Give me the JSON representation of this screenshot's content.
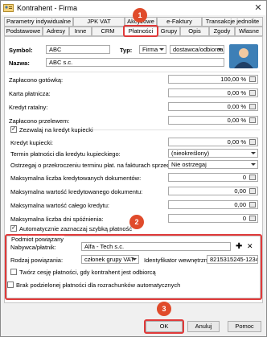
{
  "window": {
    "title": "Kontrahent - Firma"
  },
  "tabs_row1": [
    "Parametry indywidualne",
    "JPK VAT",
    "Akcyzowe",
    "e-Faktury",
    "Transakcje jednolite"
  ],
  "tabs_row2": [
    "Podstawowe",
    "Adresy",
    "Inne",
    "CRM",
    "Płatności",
    "Grupy",
    "Opis",
    "Zgody",
    "Własne"
  ],
  "symbol": {
    "label": "Symbol:",
    "value": "ABC"
  },
  "typ": {
    "label": "Typ:",
    "value": "Firma",
    "value2": "dostawca/odbiorca"
  },
  "nazwa": {
    "label": "Nazwa:",
    "value": "ABC s.c."
  },
  "payments": [
    {
      "label": "Zapłacono gotówką:",
      "value": "100,00 %"
    },
    {
      "label": "Karta płatnicza:",
      "value": "0,00 %"
    },
    {
      "label": "Kredyt ratalny:",
      "value": "0,00 %"
    },
    {
      "label": "Zapłacono przelewem:",
      "value": "0,00 %"
    }
  ],
  "credit": {
    "allow_label": "Zezwalaj na kredyt kupiecki",
    "kredyt_label": "Kredyt kupiecki:",
    "kredyt_value": "0,00 %",
    "termin_label": "Termin płatności dla kredytu kupieckiego:",
    "termin_value": "(nieokreślony)",
    "ostrzegaj_label": "Ostrzegaj o przekroczeniu terminu płat. na fakturach sprzedaży:",
    "ostrzegaj_value": "Nie ostrzegaj",
    "max_count_label": "Maksymalna liczba kredytowanych dokumentów:",
    "max_count_value": "0",
    "max_doc_label": "Maksymalna wartość kredytowanego dokumentu:",
    "max_doc_value": "0,00",
    "max_total_label": "Maksymalna wartość całego kredytu:",
    "max_total_value": "0,00",
    "max_days_label": "Maksymalna liczba dni spóźnienia:",
    "max_days_value": "0",
    "auto_label": "Automatycznie zaznaczaj szybką płatność"
  },
  "related": {
    "legend": "Podmiot powiązany",
    "nabywca_label": "Nabywca/płatnik:",
    "nabywca_value": "Alfa - Tech s.c.",
    "rodzaj_label": "Rodzaj powiązania:",
    "rodzaj_value": "członek grupy VAT",
    "id_label": "Identyfikator wewnętrzny:",
    "id_value": "8215315245-12345",
    "copy_label": "Twórz cesję płatności, gdy kontrahent jest odbiorcą"
  },
  "split_label": "Brak podzielonej płatności dla rozrachunków automatycznych",
  "buttons": {
    "ok": "OK",
    "anuluj": "Anuluj",
    "pomoc": "Pomoc"
  },
  "badges": [
    "1",
    "2",
    "3"
  ],
  "colors": {
    "highlight": "#e03a3a",
    "badge": "#e04b2b",
    "accent": "#3d7fb6"
  }
}
